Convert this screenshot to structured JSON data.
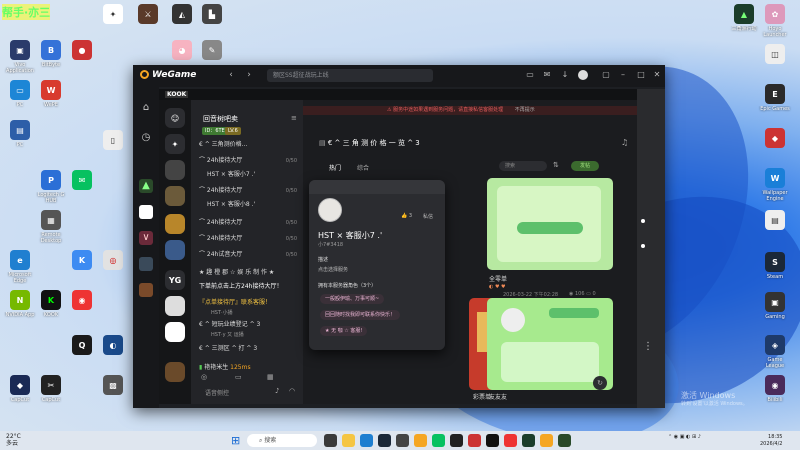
{
  "wegame": {
    "logo": "WeGame",
    "search_placeholder": "额区SS超征战玩上线",
    "icons": [
      "back-icon",
      "forward-icon",
      "message-icon",
      "mail-icon",
      "download-icon",
      "avatar",
      "minimize-icon",
      "maximize-icon",
      "close-icon"
    ]
  },
  "kook": {
    "brand": "KOOK",
    "server_name": "回音树吧卖",
    "badges": [
      "ID：6TE",
      "LV.6"
    ],
    "server_list": [
      "YG"
    ],
    "channels": [
      {
        "label": "€ ^ 三角测价格...",
        "meta": ""
      },
      {
        "label": "24h接待大厅",
        "meta": "0/50"
      },
      {
        "label": "HST × 客服小7 .'",
        "meta": ""
      },
      {
        "label": "24h接待大厅",
        "meta": "0/50"
      },
      {
        "label": "HST × 客服小8 .'",
        "meta": ""
      },
      {
        "label": "24h接待大厅",
        "meta": "0/50"
      },
      {
        "label": "24h接待大厅",
        "meta": "0/50"
      },
      {
        "label": "24h试音大厅",
        "meta": "0/50"
      },
      {
        "label": "★ 趣 橙 郡 ☆ 娱 乐 制 作 ★",
        "meta": ""
      },
      {
        "label": "下单前点击上方24h接待大厅！",
        "meta": ""
      },
      {
        "label": "『点单接待厅』联系客服！",
        "meta": ""
      },
      {
        "label": "HST·小播",
        "meta": ""
      },
      {
        "label": "€ ^ 短玩业绩登记 ^ 3",
        "meta": ""
      },
      {
        "label": "HST·y 又 运播",
        "meta": ""
      },
      {
        "label": "€ ^ 三测区 ^ 打 ^ 3",
        "meta": ""
      }
    ],
    "user_line": "艳艳米生",
    "user_ping": "125ms",
    "input_placeholder": "语音侧控",
    "banner": "服务中途如果遇到服务问题，请直接私信客服处理",
    "banner_btn": "不再提示",
    "main_title": "€ ^ 三 角 测 价 格 一 览 ^ 3",
    "tabs": [
      "热门",
      "综合"
    ],
    "main_search": "搜索",
    "main_btn": "发帖",
    "cards": [
      {
        "label": "彩票单"
      },
      {
        "label": "全零单",
        "date": "2026-03-22 下午02:28",
        "views": "106",
        "comments": "0"
      },
      {
        "label": "友友友"
      }
    ],
    "popup": {
      "name": "HST × 客服小7 .'",
      "id": "小7#3418",
      "stat1": "3",
      "stat2": "私信",
      "section1": "描述",
      "desc": "点击选择服务",
      "section2": "拥有本服务器角色（3个）",
      "roles": [
        "一般殴伊瑜、万事可顺~",
        "回回随时找我即可联系你快乐！",
        "★ 无 咖 ☆ 客服!"
      ]
    }
  },
  "desktop": {
    "icons_left": [
      "Vivo Application",
      "BitByte",
      "WePE",
      "PC",
      "Logitech G HUB",
      "Xshell",
      "Remote Desktop",
      "Microsoft Edge",
      "NVIDIA App",
      "Control Panel",
      "PotPlayer",
      "CapCut"
    ],
    "icons_right": [
      "三角洲行动",
      "Hoyo Launcher",
      "Epic Games",
      "Wallpaper Engine",
      "Steam",
      "Gaming",
      "Game League",
      "Bilibili"
    ],
    "stamp": "帮手·亦三"
  },
  "windows_watermark": {
    "line1": "激活 Windows",
    "line2": "转到'设置'以激活 Windows。"
  },
  "taskbar": {
    "weather_temp": "22°C",
    "weather_desc": "多云",
    "search_placeholder": "搜索",
    "time": "18:35",
    "date": "2026/4/2"
  }
}
